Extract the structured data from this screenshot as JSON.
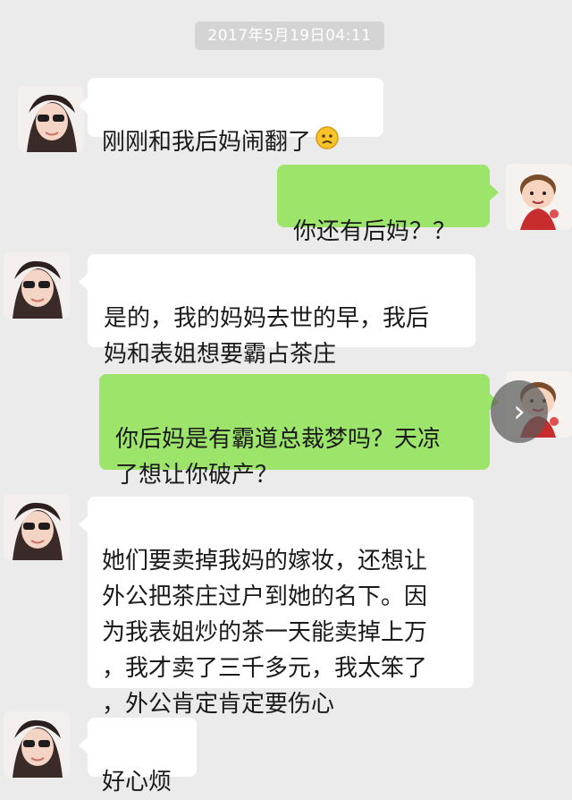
{
  "timestamp": "2017年5月19日04:11",
  "messages": [
    {
      "side": "left",
      "text": "刚刚和我后妈闹翻了",
      "emoji": "sad-face"
    },
    {
      "side": "right",
      "text": "你还有后妈？？"
    },
    {
      "side": "left",
      "text": "是的，我的妈妈去世的早，我后\n妈和表姐想要霸占茶庄"
    },
    {
      "side": "right",
      "text": "你后妈是有霸道总裁梦吗？天凉\n了想让你破产？"
    },
    {
      "side": "left",
      "text": "她们要卖掉我妈的嫁妆，还想让\n外公把茶庄过户到她的名下。因\n为我表姐炒的茶一天能卖掉上万\n，我才卖了三千多元，我太笨了\n，外公肯定肯定要伤心"
    },
    {
      "side": "left",
      "text": "好心烦"
    }
  ],
  "overlay": {
    "arrow_label": "›"
  },
  "colors": {
    "background": "#ebebeb",
    "left_bubble": "#ffffff",
    "right_bubble": "#9ce46a",
    "timestamp_bg": "#d4d4d4"
  }
}
